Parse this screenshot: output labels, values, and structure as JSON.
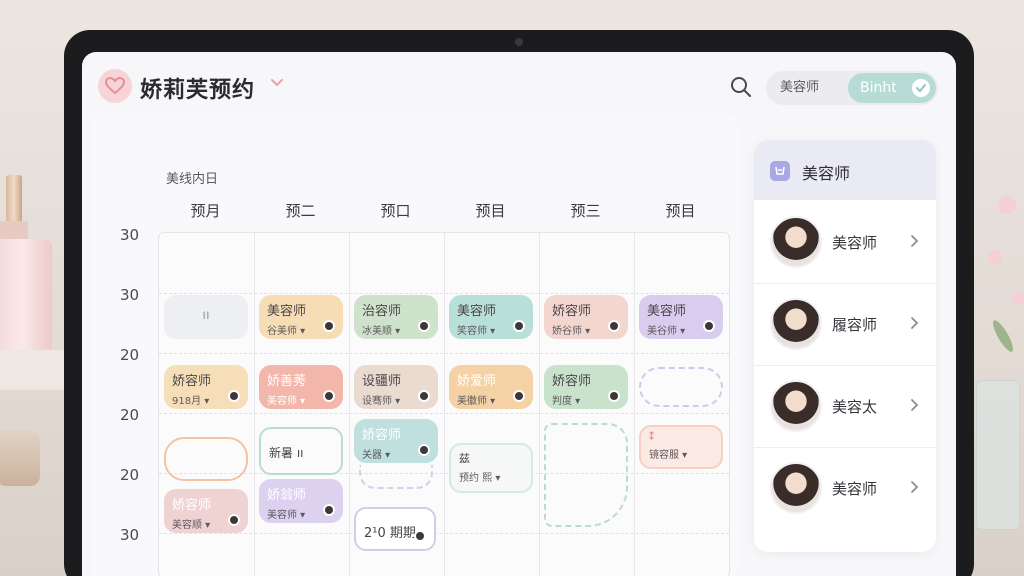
{
  "app": {
    "title": "娇莉芙预约"
  },
  "header": {
    "toggle": {
      "option_a": "美容师",
      "option_b": "Binht"
    }
  },
  "calendar": {
    "caption": "美线内日",
    "days": [
      "预月",
      "预二",
      "预口",
      "预目",
      "预三",
      "预目"
    ],
    "times": [
      "30",
      "30",
      "20",
      "20",
      "20",
      "30"
    ],
    "appointments": [
      {
        "title": "ıı",
        "sub": "",
        "color": "#eeeff3"
      },
      {
        "title": "美容师",
        "sub": "谷美师 ▾",
        "color": "#f6ddb6"
      },
      {
        "title": "治容师",
        "sub": "冰美顺 ▾",
        "color": "#cfe3cc"
      },
      {
        "title": "美容师",
        "sub": "笑容师 ▾",
        "color": "#b9dfd9"
      },
      {
        "title": "娇容师",
        "sub": "娇谷师 ▾",
        "color": "#f4d6d0"
      },
      {
        "title": "美容师",
        "sub": "美谷师 ▾",
        "color": "#d8cdef"
      },
      {
        "title": "娇容师",
        "sub": "918月 ▾",
        "color": "#f6dfb8"
      },
      {
        "title": "娇善莠",
        "sub": "美容师 ▾",
        "color": "#f3b6ab"
      },
      {
        "title": "设疆师",
        "sub": "设骞师 ▾",
        "color": "#eadbd1"
      },
      {
        "title": "娇爱师",
        "sub": "美徽师 ▾",
        "color": "#f5d2a5"
      },
      {
        "title": "娇容师",
        "sub": "判度 ▾",
        "color": "#c8e2cc"
      },
      {
        "title": "新暑 ıı",
        "sub": "",
        "color": "#ffffff"
      },
      {
        "title": "娇容师",
        "sub": "关器 ▾",
        "color": "#bfe0de"
      },
      {
        "title": "兹",
        "sub": "预约 熙 ▾",
        "color": "#f6f8f8"
      },
      {
        "title": "⁑",
        "sub": "镜容服 ▾",
        "color": "#fbe9e3"
      },
      {
        "title": "娇容师",
        "sub": "美容顺 ▾",
        "color": "#efd3d2"
      },
      {
        "title": "娇翁师",
        "sub": "美容师 ▾",
        "color": "#dcd2f0"
      },
      {
        "title": "2¹0 期期",
        "sub": "",
        "color": "#ffffff"
      }
    ]
  },
  "staff": {
    "title": "美容师",
    "members": [
      {
        "name": "美容师"
      },
      {
        "name": "履容师"
      },
      {
        "name": "美容太"
      },
      {
        "name": "美容师"
      }
    ]
  },
  "colors": {
    "accent_pink": "#f6d4d7",
    "accent_mint": "#b7dcd6",
    "accent_lavender": "#a7a8e4"
  },
  "icons": [
    "heart-icon",
    "chevron-down-icon",
    "search-icon",
    "check-icon",
    "store-icon",
    "chevron-right-icon"
  ]
}
